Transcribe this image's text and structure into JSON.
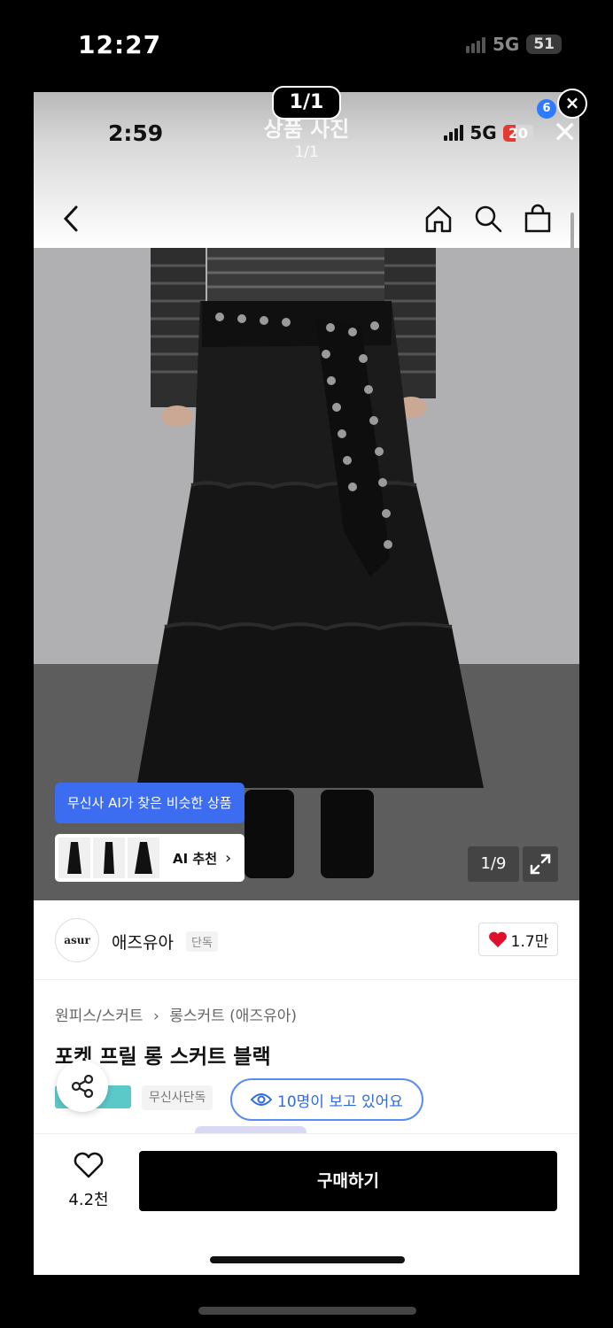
{
  "outer_status": {
    "time": "12:27",
    "network": "5G",
    "battery": "51"
  },
  "viewer": {
    "counter": "1/1",
    "close_symbol": "×",
    "ghost_title": "상품 사진",
    "ghost_count": "1/1"
  },
  "inner_status": {
    "time": "2:59",
    "network": "5G",
    "battery": "20",
    "battery_color": "#e53935"
  },
  "nav": {
    "cart_badge": "6",
    "badge_color": "#2f7bff"
  },
  "image": {
    "ai_bubble": "무신사 AI가 찾은 비슷한 상품",
    "ai_recommend": "AI 추천",
    "chevron": "›",
    "counter": "1/9"
  },
  "brand": {
    "logo_text": "asur",
    "name": "애즈유아",
    "tag": "단독",
    "likes": "1.7만"
  },
  "product": {
    "breadcrumb_category": "원피스/스커트",
    "breadcrumb_sep": "›",
    "breadcrumb_sub": "롱스커트 (애즈유아)",
    "title": "포켓 프릴 롱 스커트 블랙",
    "exclusive_tag": "무신사단독",
    "viewers": "10명이 보고 있어요",
    "accent": "#3c6df0"
  },
  "bottom": {
    "wish_count": "4.2천",
    "buy_label": "구매하기"
  }
}
